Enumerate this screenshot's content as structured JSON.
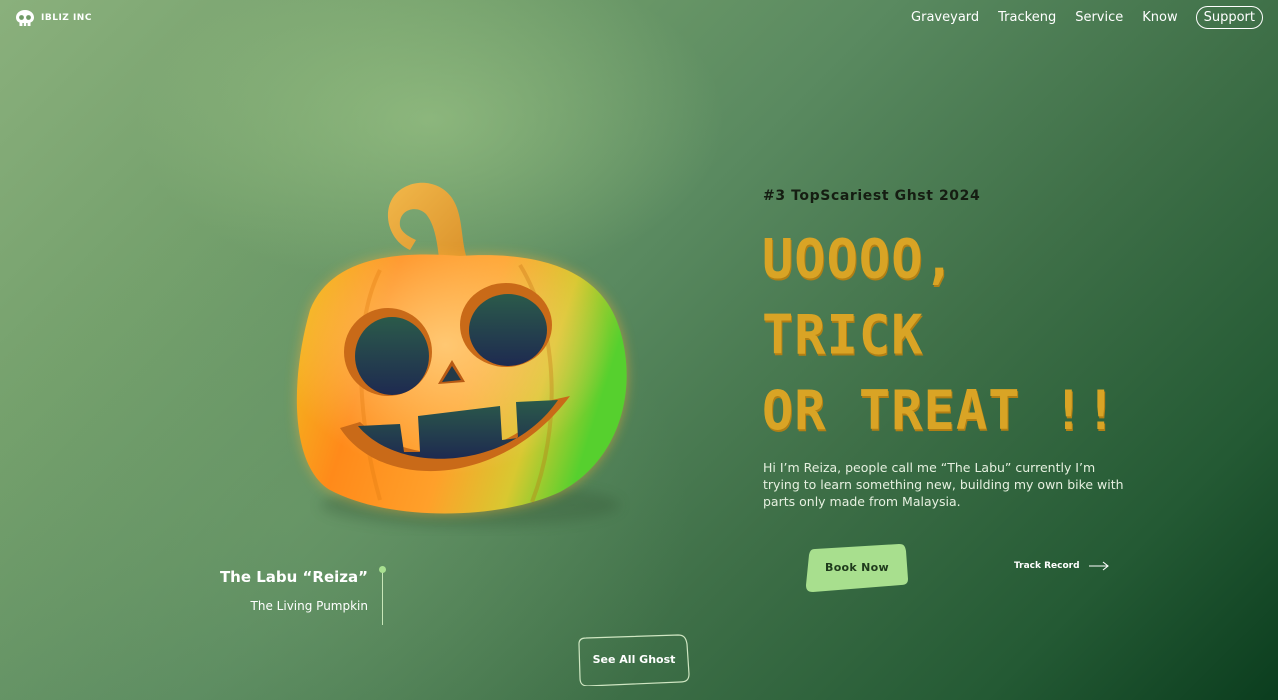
{
  "brand": {
    "name": "IBLIZ INC",
    "icon": "skull-icon"
  },
  "nav": {
    "items": [
      "Graveyard",
      "Trackeng",
      "Service",
      "Know"
    ],
    "support": "Support"
  },
  "hero": {
    "kicker": "#3 TopScariest Ghst 2024",
    "headline": [
      "UOOOO,",
      "TRICK",
      "OR TREAT !!"
    ],
    "bio": "Hi I’m Reiza, people call me “The Labu” currently I’m trying to learn something new, building my own bike with parts only made from Malaysia.",
    "book_label": "Book Now",
    "track_label": "Track Record",
    "track_icon": "arrow-right-icon"
  },
  "character": {
    "name": "The Labu “Reiza”",
    "subtitle": "The Living Pumpkin",
    "image": "pumpkin-icon"
  },
  "see_all_label": "See All Ghost",
  "colors": {
    "accent": "#d9a425",
    "button": "#a8df8e",
    "dark": "#0b3d1e"
  }
}
